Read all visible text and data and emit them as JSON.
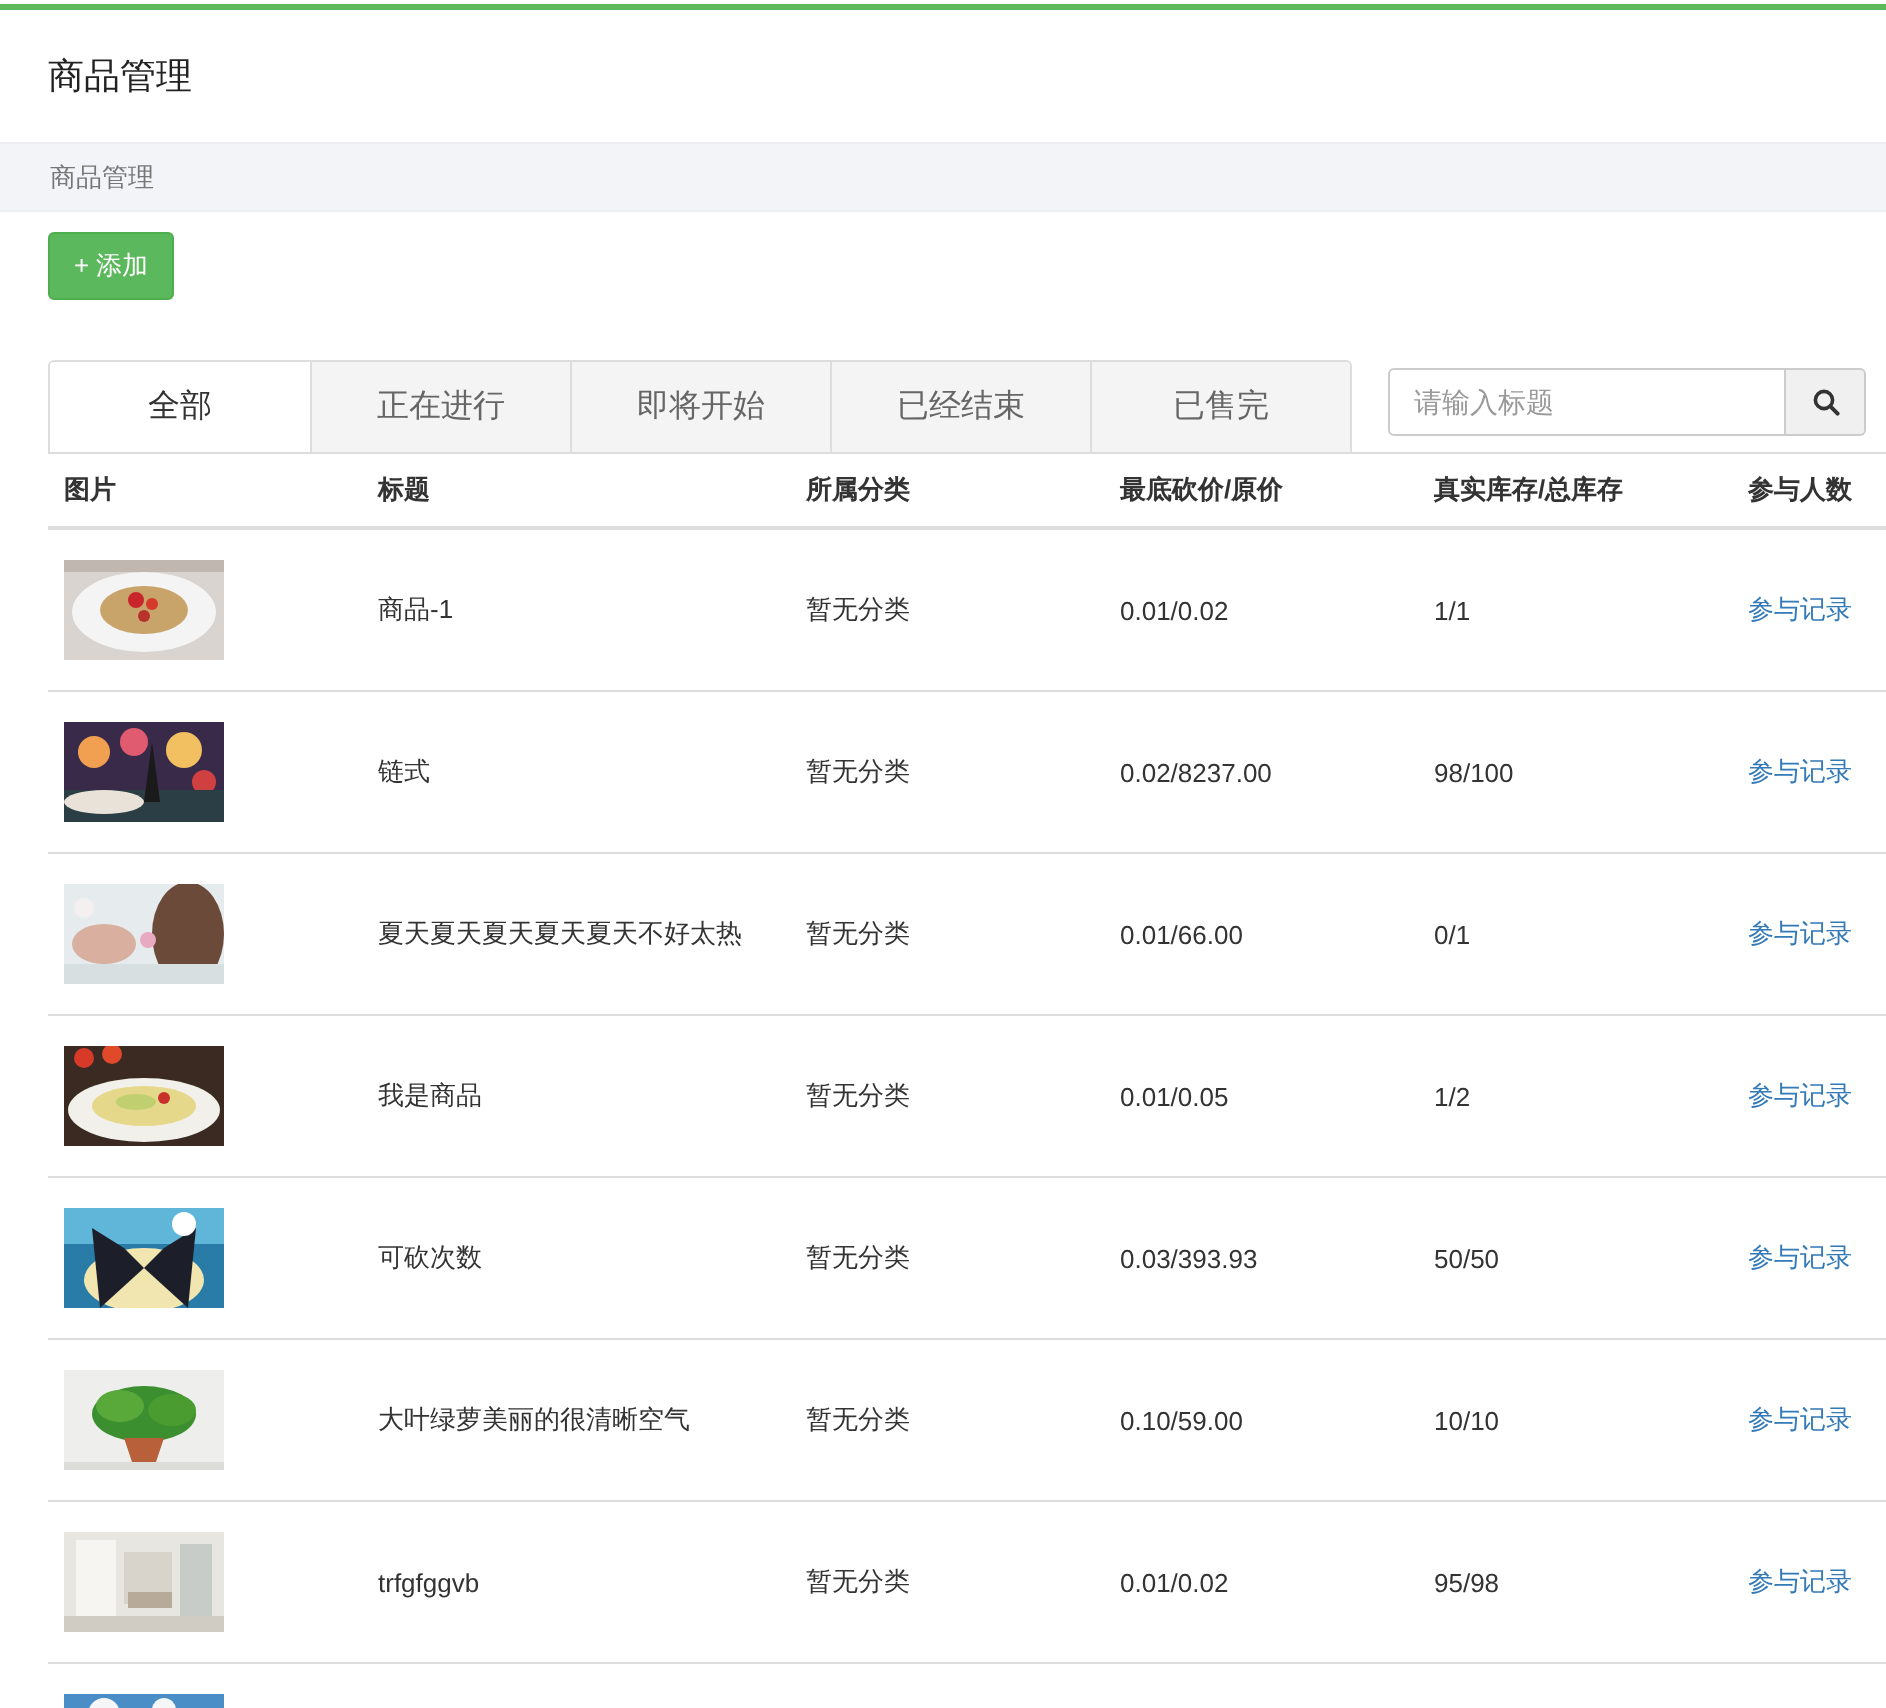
{
  "page_title": "商品管理",
  "breadcrumb": "商品管理",
  "add_button": "+ 添加",
  "tabs": [
    {
      "label": "全部",
      "selected": true
    },
    {
      "label": "正在进行",
      "selected": false
    },
    {
      "label": "即将开始",
      "selected": false
    },
    {
      "label": "已经结束",
      "selected": false
    },
    {
      "label": "已售完",
      "selected": false
    }
  ],
  "search": {
    "placeholder": "请输入标题"
  },
  "table": {
    "columns": [
      "图片",
      "标题",
      "所属分类",
      "最底砍价/原价",
      "真实库存/总库存",
      "参与人数"
    ],
    "rows": [
      {
        "image": {
          "kind": "picture"
        },
        "title": "商品-1",
        "category": "暂无分类",
        "price": "0.01/0.02",
        "stock": "1/1",
        "action": "参与记录"
      },
      {
        "image": {
          "kind": "picture"
        },
        "title": "链式",
        "category": "暂无分类",
        "price": "0.02/8237.00",
        "stock": "98/100",
        "action": "参与记录"
      },
      {
        "image": {
          "kind": "picture"
        },
        "title": "夏天夏天夏天夏天夏天不好太热",
        "category": "暂无分类",
        "price": "0.01/66.00",
        "stock": "0/1",
        "action": "参与记录"
      },
      {
        "image": {
          "kind": "picture"
        },
        "title": "我是商品",
        "category": "暂无分类",
        "price": "0.01/0.05",
        "stock": "1/2",
        "action": "参与记录"
      },
      {
        "image": {
          "kind": "picture"
        },
        "title": "可砍次数",
        "category": "暂无分类",
        "price": "0.03/393.93",
        "stock": "50/50",
        "action": "参与记录"
      },
      {
        "image": {
          "kind": "picture"
        },
        "title": "大叶绿萝美丽的很清晰空气",
        "category": "暂无分类",
        "price": "0.10/59.00",
        "stock": "10/10",
        "action": "参与记录"
      },
      {
        "image": {
          "kind": "picture"
        },
        "title": "trfgfggvb",
        "category": "暂无分类",
        "price": "0.01/0.02",
        "stock": "95/98",
        "action": "参与记录"
      },
      {
        "image": {
          "kind": "picture"
        }
      }
    ]
  }
}
